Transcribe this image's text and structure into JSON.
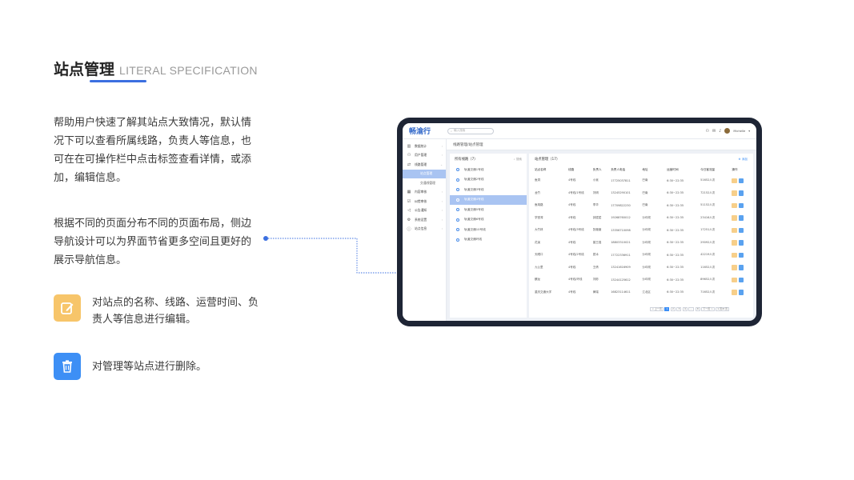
{
  "header": {
    "title_zh": "站点管理",
    "title_en": "LITERAL SPECIFICATION"
  },
  "descriptions": {
    "para1": "帮助用户快速了解其站点大致情况，默认情况下可以查看所属线路，负责人等信息，也可在在可操作栏中点击标签查看详情，或添加，编辑信息。",
    "para2": "根据不同的页面分布不同的页面布局，侧边导航设计可以为界面节省更多空间且更好的展示导航信息。"
  },
  "features": {
    "edit_text": "对站点的名称、线路、运营时间、负责人等信息进行编辑。",
    "delete_text": "对管理等站点进行删除。"
  },
  "colors": {
    "accent": "#3b6fe0",
    "edit": "#f7c56a",
    "delete": "#3d8ff5",
    "device": "#1e2535"
  },
  "app": {
    "logo": "畅渝行",
    "search_placeholder": "输入搜索",
    "username": "Michelle",
    "breadcrumb": "线路管理/站点管理",
    "sidebar": {
      "items": [
        {
          "label": "数据统计",
          "icon": "bar-chart-icon"
        },
        {
          "label": "用户管理",
          "icon": "user-icon"
        },
        {
          "label": "线路管理",
          "icon": "route-icon"
        }
      ],
      "subs": [
        {
          "label": "站点管理"
        },
        {
          "label": "交通线管理"
        }
      ],
      "items2": [
        {
          "label": "内容审核",
          "icon": "calendar-icon"
        },
        {
          "label": "纠错审核",
          "icon": "check-icon"
        },
        {
          "label": "公告通知",
          "icon": "speaker-icon"
        },
        {
          "label": "系统设置",
          "icon": "gear-icon"
        },
        {
          "label": "站点信息",
          "icon": "info-icon"
        }
      ]
    },
    "lines_panel": {
      "title": "所有线路（7）",
      "search_label": "搜索",
      "items": [
        "轨道交通1号线",
        "轨道交通2号线",
        "轨道交通3号线",
        "轨道交通4号线",
        "轨道交通5号线",
        "轨道交通6号线",
        "轨道交通10号线",
        "轨道交通环线"
      ]
    },
    "station_panel": {
      "title": "站点管理（17）",
      "add_label": "添加",
      "columns": [
        "站点名称",
        "线路",
        "负责人",
        "负责人电话",
        "地址",
        "运营时间",
        "今日客流量",
        "操作"
      ],
      "rows": [
        [
          "鱼洞",
          "4号线",
          "小吴",
          "17725037811",
          "巴南",
          "6:30~22:35",
          "51652人次"
        ],
        [
          "龙竹",
          "4号线/1号线",
          "刘明",
          "13245290101",
          "巴南",
          "6:30~22:35",
          "72152人次"
        ],
        [
          "鱼胡路",
          "4号线",
          "李华",
          "17709822230",
          "巴南",
          "6:30~22:35",
          "51152人次"
        ],
        [
          "学堂湾",
          "4号线",
          "钟斌斌",
          "19268760012",
          "沙坪坝",
          "6:30~22:35",
          "23416人次"
        ],
        [
          "大竹林",
          "4号线/3号线",
          "张薇薇",
          "13356710098",
          "沙坪坝",
          "6:30~22:35",
          "17251人次"
        ],
        [
          "花溪",
          "4号线",
          "曾王强",
          "18803310021",
          "沙坪坝",
          "6:30~22:35",
          "29092人次"
        ],
        [
          "天眼口",
          "4号线/2号线",
          "夏冰",
          "17722336911",
          "沙坪坝",
          "6:30~22:35",
          "42219人次"
        ],
        [
          "九公里",
          "4号线",
          "王倩",
          "13241616909",
          "沙坪坝",
          "6:30~22:35",
          "11652人次"
        ],
        [
          "麒龙",
          "4号线/环线",
          "刘彬",
          "13244125612",
          "沙坪坝",
          "6:30~22:35",
          "89652人次"
        ],
        [
          "重庆交通大学",
          "4号线",
          "黄瑞",
          "16823114611",
          "江北区",
          "6:30~22:35",
          "71652人次"
        ]
      ],
      "pager": [
        "< 上一页",
        "1",
        "2",
        "3",
        "4",
        "...",
        "8",
        "下一页 >",
        "1 页/8 页"
      ]
    }
  }
}
